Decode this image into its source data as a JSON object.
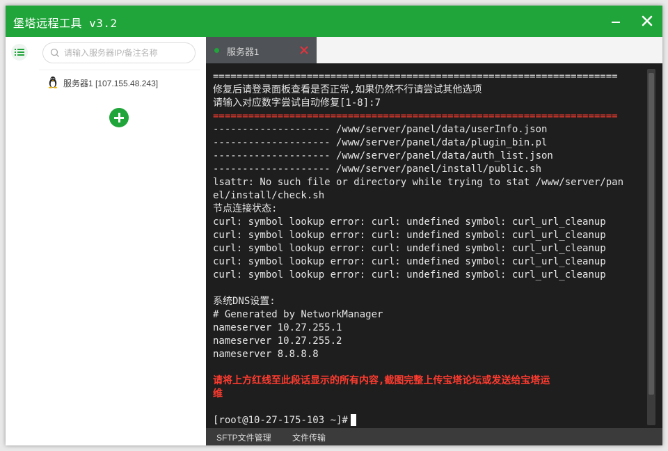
{
  "titlebar": {
    "title": "堡塔远程工具 v3.2"
  },
  "sidebar": {
    "search_placeholder": "请输入服务器IP/备注名称",
    "servers": [
      {
        "label": "服务器1 [107.155.48.243]",
        "os_icon": "linux-tux-icon"
      }
    ]
  },
  "tabs": [
    {
      "label": "服务器1",
      "status_color": "#20a53a"
    }
  ],
  "terminal": {
    "lines": [
      {
        "text": "=====================================================================",
        "style": "rule"
      },
      {
        "text": "修复后请登录面板查看是否正常,如果仍然不行请尝试其他选项",
        "style": "normal"
      },
      {
        "text": "请输入对应数字尝试自动修复[1-8]:7",
        "style": "normal"
      },
      {
        "text": "=====================================================================",
        "style": "rule-red"
      },
      {
        "text": "-------------------- /www/server/panel/data/userInfo.json",
        "style": "normal"
      },
      {
        "text": "-------------------- /www/server/panel/data/plugin_bin.pl",
        "style": "normal"
      },
      {
        "text": "-------------------- /www/server/panel/data/auth_list.json",
        "style": "normal"
      },
      {
        "text": "-------------------- /www/server/panel/install/public.sh",
        "style": "normal"
      },
      {
        "text": "lsattr: No such file or directory while trying to stat /www/server/pan",
        "style": "normal"
      },
      {
        "text": "el/install/check.sh",
        "style": "normal"
      },
      {
        "text": "节点连接状态:",
        "style": "normal"
      },
      {
        "text": "curl: symbol lookup error: curl: undefined symbol: curl_url_cleanup",
        "style": "normal"
      },
      {
        "text": "curl: symbol lookup error: curl: undefined symbol: curl_url_cleanup",
        "style": "normal"
      },
      {
        "text": "curl: symbol lookup error: curl: undefined symbol: curl_url_cleanup",
        "style": "normal"
      },
      {
        "text": "curl: symbol lookup error: curl: undefined symbol: curl_url_cleanup",
        "style": "normal"
      },
      {
        "text": "curl: symbol lookup error: curl: undefined symbol: curl_url_cleanup",
        "style": "normal"
      },
      {
        "text": "",
        "style": "normal"
      },
      {
        "text": "系统DNS设置:",
        "style": "normal"
      },
      {
        "text": "# Generated by NetworkManager",
        "style": "normal"
      },
      {
        "text": "nameserver 10.27.255.1",
        "style": "normal"
      },
      {
        "text": "nameserver 10.27.255.2",
        "style": "normal"
      },
      {
        "text": "nameserver 8.8.8.8",
        "style": "normal"
      },
      {
        "text": "",
        "style": "normal"
      },
      {
        "text": "请将上方红线至此段话显示的所有内容,截图完整上传宝塔论坛或发送给宝塔运",
        "style": "red"
      },
      {
        "text": "维",
        "style": "red"
      },
      {
        "text": "",
        "style": "normal"
      },
      {
        "text": "[root@10-27-175-103 ~]#",
        "style": "prompt"
      }
    ]
  },
  "bottom_tabs": [
    {
      "label": "SFTP文件管理"
    },
    {
      "label": "文件传输"
    }
  ],
  "colors": {
    "brand_green": "#20a53a",
    "terminal_bg": "#1e1e1e",
    "error_red": "#ff3b2f"
  }
}
